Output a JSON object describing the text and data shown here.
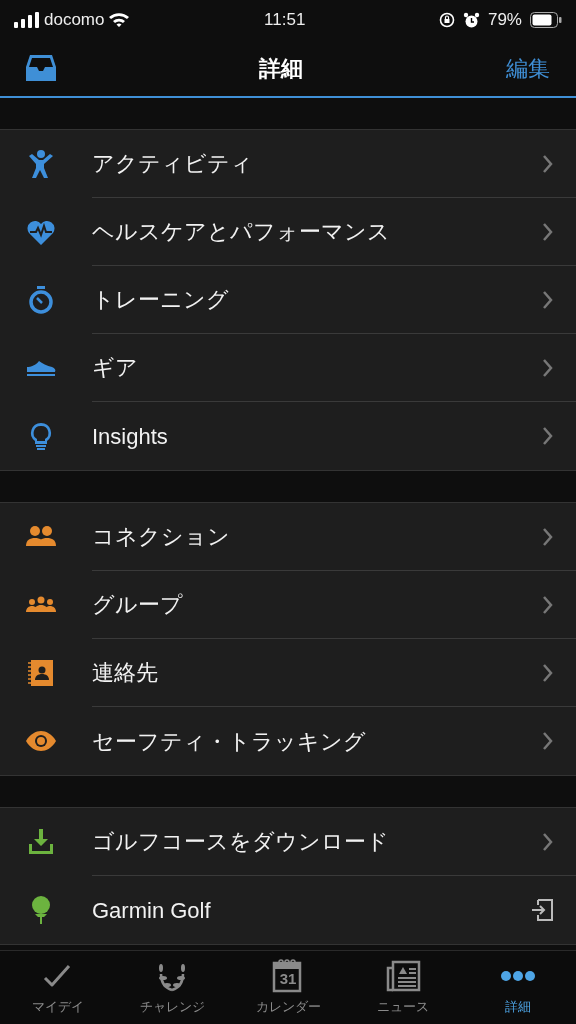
{
  "status_bar": {
    "carrier": "docomo",
    "time": "11:51",
    "battery": "79%"
  },
  "header": {
    "title": "詳細",
    "edit": "編集"
  },
  "groups": [
    {
      "color": "#3d8fdc",
      "items": [
        {
          "label": "アクティビティ",
          "kind": "submenu"
        },
        {
          "label": "ヘルスケアとパフォーマンス",
          "kind": "submenu"
        },
        {
          "label": "トレーニング",
          "kind": "submenu"
        },
        {
          "label": "ギア",
          "kind": "submenu"
        },
        {
          "label": "Insights",
          "kind": "submenu"
        }
      ]
    },
    {
      "color": "#e58a2e",
      "items": [
        {
          "label": "コネクション",
          "kind": "submenu"
        },
        {
          "label": "グループ",
          "kind": "submenu"
        },
        {
          "label": "連絡先",
          "kind": "submenu"
        },
        {
          "label": "セーフティ・トラッキング",
          "kind": "submenu"
        }
      ]
    },
    {
      "color": "#6cb33f",
      "items": [
        {
          "label": "ゴルフコースをダウンロード",
          "kind": "submenu"
        },
        {
          "label": "Garmin Golf",
          "kind": "external"
        }
      ]
    }
  ],
  "tabs": [
    {
      "label": "マイデイ",
      "selected": false
    },
    {
      "label": "チャレンジ",
      "selected": false
    },
    {
      "label": "カレンダー",
      "icon_text": "31",
      "selected": false
    },
    {
      "label": "ニュース",
      "selected": false
    },
    {
      "label": "詳細",
      "selected": true
    }
  ]
}
